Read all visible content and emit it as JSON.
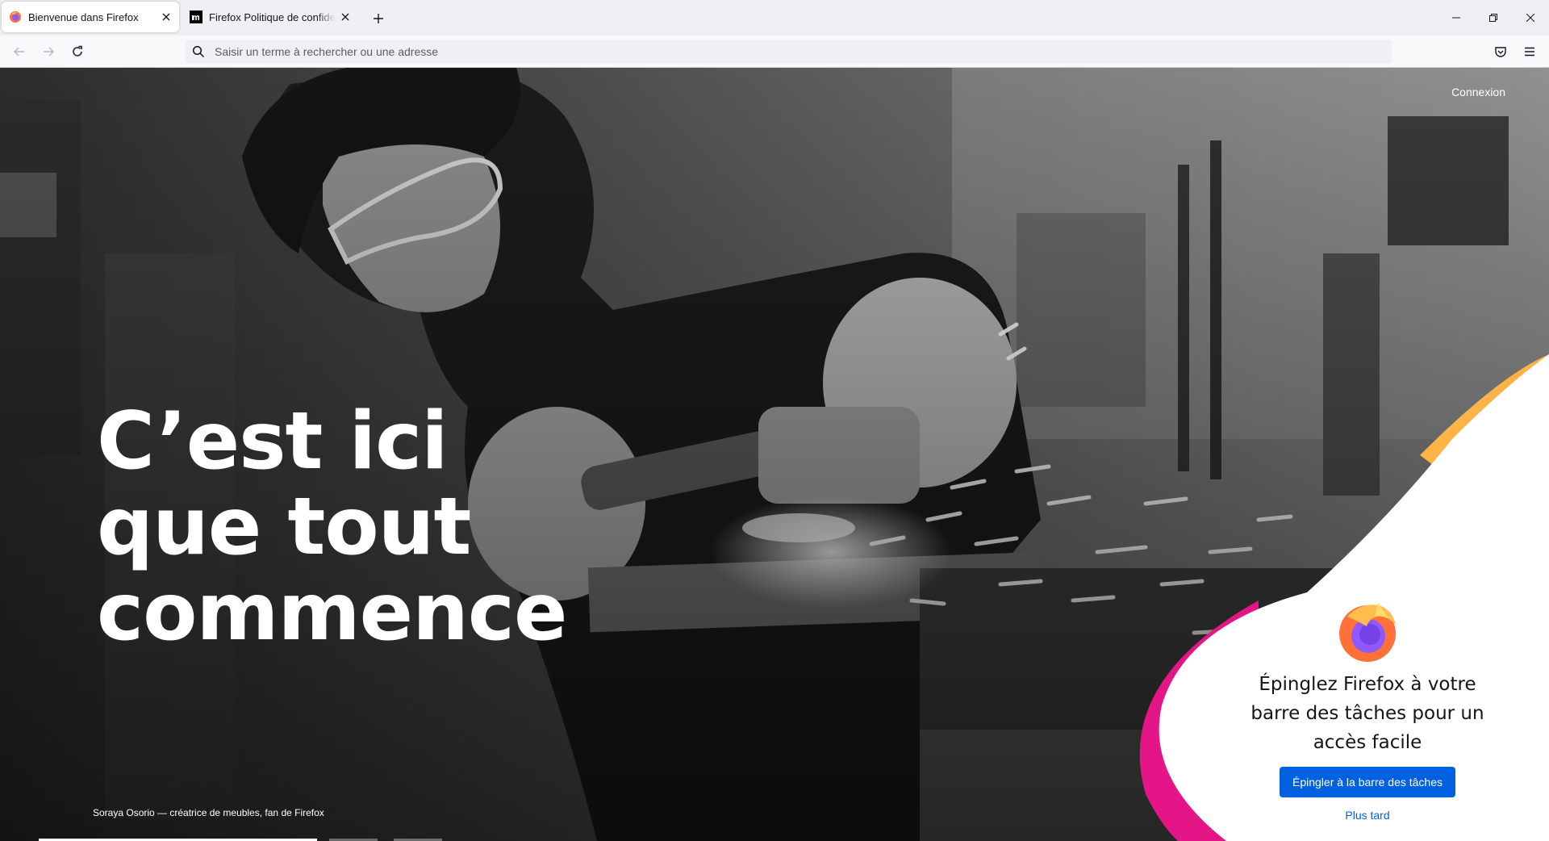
{
  "browser": {
    "tabs": [
      {
        "title": "Bienvenue dans Firefox",
        "active": true,
        "favicon": "firefox-logo-icon"
      },
      {
        "title": "Firefox Politique de confidentialité",
        "active": false,
        "favicon": "mozilla-m-icon"
      }
    ],
    "window_controls": [
      "minimize-icon",
      "restore-icon",
      "close-icon"
    ],
    "nav": {
      "url_placeholder": "Saisir un terme à rechercher ou une adresse",
      "url_value": ""
    },
    "toolbar_icons": [
      "back-arrow-icon",
      "forward-arrow-icon",
      "reload-icon",
      "search-icon",
      "pocket-icon",
      "menu-icon"
    ]
  },
  "page": {
    "signin": "Connexion",
    "headline": [
      "C’est ici",
      "que tout",
      "commence"
    ],
    "photo_caption": "Soraya Osorio — créatrice de meubles, fan de Firefox",
    "progress": {
      "steps": 3,
      "current": 1
    },
    "pin_card": {
      "title": "Épinglez Firefox à votre barre des tâches pour un accès facile",
      "primary_button": "Épingler à la barre des tâches",
      "secondary_link": "Plus tard"
    }
  },
  "colors": {
    "accent_blue": "#0061e0",
    "brand_pink": "#e31587",
    "brand_orange": "#ff9f3a",
    "chrome_bg": "#f0f0f4"
  }
}
